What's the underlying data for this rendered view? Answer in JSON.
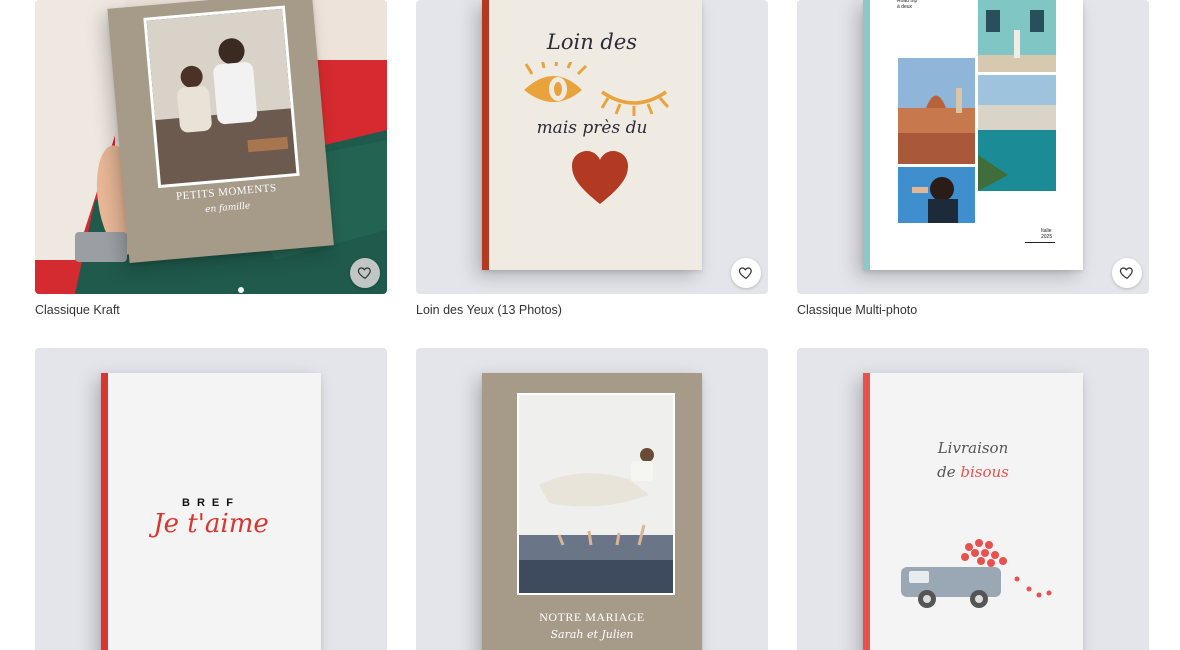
{
  "products": [
    {
      "name": "Classique Kraft",
      "cover_title": "PETITS MOMENTS",
      "cover_subtitle": "en famille"
    },
    {
      "name": "Loin des Yeux (13 Photos)",
      "cover_line1": "Loin des",
      "cover_line2": "mais près du"
    },
    {
      "name": "Classique Multi-photo",
      "cover_header": "Road trip\nà deux",
      "cover_footer_1": "Italie",
      "cover_footer_2": "2025"
    },
    {
      "name": "",
      "cover_line1": "BREF",
      "cover_line2": "Je t'aime"
    },
    {
      "name": "",
      "cover_title": "NOTRE MARIAGE",
      "cover_subtitle": "Sarah et Julien"
    },
    {
      "name": "",
      "cover_line1": "Livraison",
      "cover_line2a": "de ",
      "cover_line2b": "bisous"
    }
  ],
  "favorite_icon": "heart-outline-icon",
  "colors": {
    "thumb_bg": "#e4e5ea",
    "kraft": "#a69a89",
    "accent_red": "#d9362f",
    "rust": "#b23a22",
    "teal_spine": "#8dc8c6",
    "ink": "#2b2b3a",
    "caption": "#333333"
  }
}
